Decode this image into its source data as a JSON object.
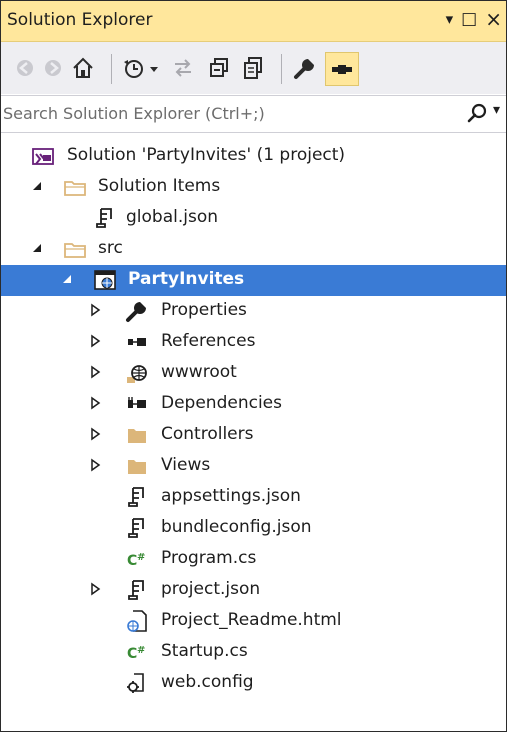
{
  "panel": {
    "title": "Solution Explorer",
    "controls": {
      "dropdown": "▾",
      "maximize": "□",
      "close": "×"
    }
  },
  "toolbar": {
    "buttons": [
      "back",
      "forward",
      "home",
      "history",
      "sync",
      "collapse-all",
      "show-all-files",
      "properties",
      "preview"
    ]
  },
  "search": {
    "placeholder": "Search Solution Explorer (Ctrl+;)",
    "value": ""
  },
  "tree": [
    {
      "label": "Solution 'PartyInvites' (1 project)",
      "icon": "solution-icon",
      "expander": "none",
      "depth": 0
    },
    {
      "label": "Solution Items",
      "icon": "folder-icon",
      "expander": "expanded",
      "depth": 0
    },
    {
      "label": "global.json",
      "icon": "json-file-icon",
      "expander": "none",
      "depth": 1
    },
    {
      "label": "src",
      "icon": "folder-icon",
      "expander": "expanded",
      "depth": 0
    },
    {
      "label": "PartyInvites",
      "icon": "web-project-icon",
      "expander": "expanded",
      "depth": 1,
      "selected": true
    },
    {
      "label": "Properties",
      "icon": "wrench-icon",
      "expander": "collapsed",
      "depth": 2
    },
    {
      "label": "References",
      "icon": "references-icon",
      "expander": "collapsed",
      "depth": 2
    },
    {
      "label": "wwwroot",
      "icon": "globe-icon",
      "expander": "collapsed",
      "depth": 2
    },
    {
      "label": "Dependencies",
      "icon": "dependencies-icon",
      "expander": "collapsed",
      "depth": 2
    },
    {
      "label": "Controllers",
      "icon": "folder-icon",
      "expander": "collapsed",
      "depth": 2
    },
    {
      "label": "Views",
      "icon": "folder-icon",
      "expander": "collapsed",
      "depth": 2
    },
    {
      "label": "appsettings.json",
      "icon": "json-file-icon",
      "expander": "none",
      "depth": 2
    },
    {
      "label": "bundleconfig.json",
      "icon": "json-file-icon",
      "expander": "none",
      "depth": 2
    },
    {
      "label": "Program.cs",
      "icon": "csharp-file-icon",
      "expander": "none",
      "depth": 2
    },
    {
      "label": "project.json",
      "icon": "json-file-icon",
      "expander": "collapsed",
      "depth": 2
    },
    {
      "label": "Project_Readme.html",
      "icon": "html-file-icon",
      "expander": "none",
      "depth": 2
    },
    {
      "label": "Startup.cs",
      "icon": "csharp-file-icon",
      "expander": "none",
      "depth": 2
    },
    {
      "label": "web.config",
      "icon": "config-file-icon",
      "expander": "none",
      "depth": 2
    }
  ],
  "colors": {
    "titlebar": "#ffe79c",
    "toolbar": "#eeeef2",
    "selection": "#3a7bd5",
    "folder": "#dcb67a",
    "csharp": "#388a34",
    "solution": "#68217a"
  }
}
